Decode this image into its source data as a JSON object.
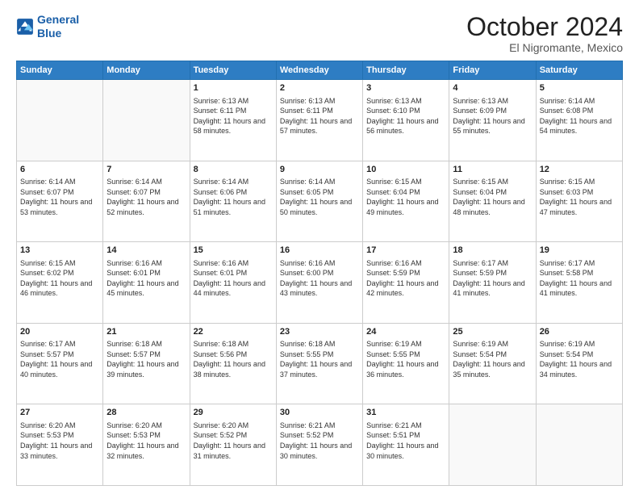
{
  "header": {
    "logo_line1": "General",
    "logo_line2": "Blue",
    "title": "October 2024",
    "subtitle": "El Nigromante, Mexico"
  },
  "weekdays": [
    "Sunday",
    "Monday",
    "Tuesday",
    "Wednesday",
    "Thursday",
    "Friday",
    "Saturday"
  ],
  "weeks": [
    [
      {
        "day": "",
        "sunrise": "",
        "sunset": "",
        "daylight": ""
      },
      {
        "day": "",
        "sunrise": "",
        "sunset": "",
        "daylight": ""
      },
      {
        "day": "1",
        "sunrise": "Sunrise: 6:13 AM",
        "sunset": "Sunset: 6:11 PM",
        "daylight": "Daylight: 11 hours and 58 minutes."
      },
      {
        "day": "2",
        "sunrise": "Sunrise: 6:13 AM",
        "sunset": "Sunset: 6:11 PM",
        "daylight": "Daylight: 11 hours and 57 minutes."
      },
      {
        "day": "3",
        "sunrise": "Sunrise: 6:13 AM",
        "sunset": "Sunset: 6:10 PM",
        "daylight": "Daylight: 11 hours and 56 minutes."
      },
      {
        "day": "4",
        "sunrise": "Sunrise: 6:13 AM",
        "sunset": "Sunset: 6:09 PM",
        "daylight": "Daylight: 11 hours and 55 minutes."
      },
      {
        "day": "5",
        "sunrise": "Sunrise: 6:14 AM",
        "sunset": "Sunset: 6:08 PM",
        "daylight": "Daylight: 11 hours and 54 minutes."
      }
    ],
    [
      {
        "day": "6",
        "sunrise": "Sunrise: 6:14 AM",
        "sunset": "Sunset: 6:07 PM",
        "daylight": "Daylight: 11 hours and 53 minutes."
      },
      {
        "day": "7",
        "sunrise": "Sunrise: 6:14 AM",
        "sunset": "Sunset: 6:07 PM",
        "daylight": "Daylight: 11 hours and 52 minutes."
      },
      {
        "day": "8",
        "sunrise": "Sunrise: 6:14 AM",
        "sunset": "Sunset: 6:06 PM",
        "daylight": "Daylight: 11 hours and 51 minutes."
      },
      {
        "day": "9",
        "sunrise": "Sunrise: 6:14 AM",
        "sunset": "Sunset: 6:05 PM",
        "daylight": "Daylight: 11 hours and 50 minutes."
      },
      {
        "day": "10",
        "sunrise": "Sunrise: 6:15 AM",
        "sunset": "Sunset: 6:04 PM",
        "daylight": "Daylight: 11 hours and 49 minutes."
      },
      {
        "day": "11",
        "sunrise": "Sunrise: 6:15 AM",
        "sunset": "Sunset: 6:04 PM",
        "daylight": "Daylight: 11 hours and 48 minutes."
      },
      {
        "day": "12",
        "sunrise": "Sunrise: 6:15 AM",
        "sunset": "Sunset: 6:03 PM",
        "daylight": "Daylight: 11 hours and 47 minutes."
      }
    ],
    [
      {
        "day": "13",
        "sunrise": "Sunrise: 6:15 AM",
        "sunset": "Sunset: 6:02 PM",
        "daylight": "Daylight: 11 hours and 46 minutes."
      },
      {
        "day": "14",
        "sunrise": "Sunrise: 6:16 AM",
        "sunset": "Sunset: 6:01 PM",
        "daylight": "Daylight: 11 hours and 45 minutes."
      },
      {
        "day": "15",
        "sunrise": "Sunrise: 6:16 AM",
        "sunset": "Sunset: 6:01 PM",
        "daylight": "Daylight: 11 hours and 44 minutes."
      },
      {
        "day": "16",
        "sunrise": "Sunrise: 6:16 AM",
        "sunset": "Sunset: 6:00 PM",
        "daylight": "Daylight: 11 hours and 43 minutes."
      },
      {
        "day": "17",
        "sunrise": "Sunrise: 6:16 AM",
        "sunset": "Sunset: 5:59 PM",
        "daylight": "Daylight: 11 hours and 42 minutes."
      },
      {
        "day": "18",
        "sunrise": "Sunrise: 6:17 AM",
        "sunset": "Sunset: 5:59 PM",
        "daylight": "Daylight: 11 hours and 41 minutes."
      },
      {
        "day": "19",
        "sunrise": "Sunrise: 6:17 AM",
        "sunset": "Sunset: 5:58 PM",
        "daylight": "Daylight: 11 hours and 41 minutes."
      }
    ],
    [
      {
        "day": "20",
        "sunrise": "Sunrise: 6:17 AM",
        "sunset": "Sunset: 5:57 PM",
        "daylight": "Daylight: 11 hours and 40 minutes."
      },
      {
        "day": "21",
        "sunrise": "Sunrise: 6:18 AM",
        "sunset": "Sunset: 5:57 PM",
        "daylight": "Daylight: 11 hours and 39 minutes."
      },
      {
        "day": "22",
        "sunrise": "Sunrise: 6:18 AM",
        "sunset": "Sunset: 5:56 PM",
        "daylight": "Daylight: 11 hours and 38 minutes."
      },
      {
        "day": "23",
        "sunrise": "Sunrise: 6:18 AM",
        "sunset": "Sunset: 5:55 PM",
        "daylight": "Daylight: 11 hours and 37 minutes."
      },
      {
        "day": "24",
        "sunrise": "Sunrise: 6:19 AM",
        "sunset": "Sunset: 5:55 PM",
        "daylight": "Daylight: 11 hours and 36 minutes."
      },
      {
        "day": "25",
        "sunrise": "Sunrise: 6:19 AM",
        "sunset": "Sunset: 5:54 PM",
        "daylight": "Daylight: 11 hours and 35 minutes."
      },
      {
        "day": "26",
        "sunrise": "Sunrise: 6:19 AM",
        "sunset": "Sunset: 5:54 PM",
        "daylight": "Daylight: 11 hours and 34 minutes."
      }
    ],
    [
      {
        "day": "27",
        "sunrise": "Sunrise: 6:20 AM",
        "sunset": "Sunset: 5:53 PM",
        "daylight": "Daylight: 11 hours and 33 minutes."
      },
      {
        "day": "28",
        "sunrise": "Sunrise: 6:20 AM",
        "sunset": "Sunset: 5:53 PM",
        "daylight": "Daylight: 11 hours and 32 minutes."
      },
      {
        "day": "29",
        "sunrise": "Sunrise: 6:20 AM",
        "sunset": "Sunset: 5:52 PM",
        "daylight": "Daylight: 11 hours and 31 minutes."
      },
      {
        "day": "30",
        "sunrise": "Sunrise: 6:21 AM",
        "sunset": "Sunset: 5:52 PM",
        "daylight": "Daylight: 11 hours and 30 minutes."
      },
      {
        "day": "31",
        "sunrise": "Sunrise: 6:21 AM",
        "sunset": "Sunset: 5:51 PM",
        "daylight": "Daylight: 11 hours and 30 minutes."
      },
      {
        "day": "",
        "sunrise": "",
        "sunset": "",
        "daylight": ""
      },
      {
        "day": "",
        "sunrise": "",
        "sunset": "",
        "daylight": ""
      }
    ]
  ]
}
